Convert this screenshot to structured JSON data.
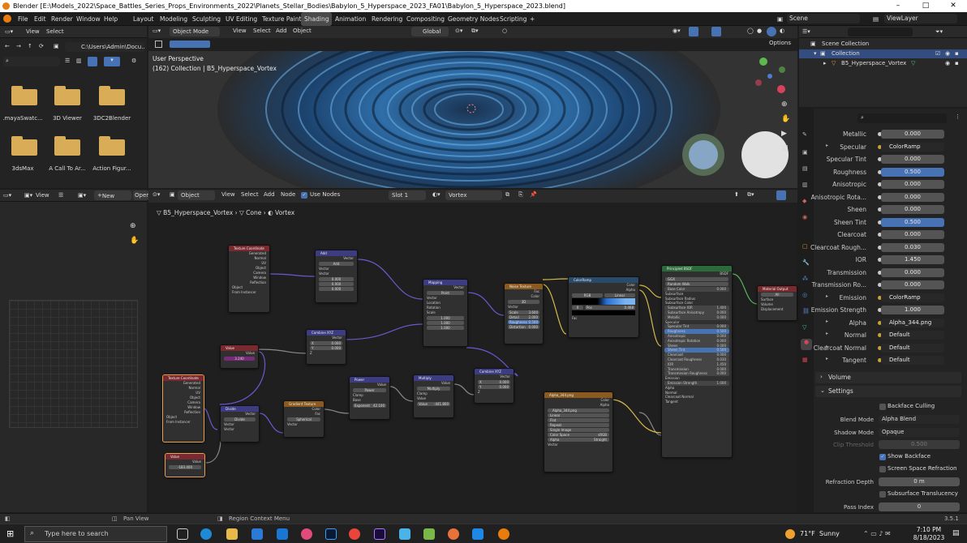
{
  "window": {
    "title": "Blender [E:\\Models_2022\\Space_Battles_Series_Props_Environments_2022\\Planets_Stellar_Bodies\\Babylon_5_Hyperspace_2023_FA01\\Babylon_5_Hyperspace_2023.blend]",
    "minimize": "–",
    "maximize": "□",
    "close": "✕"
  },
  "menu": {
    "file": "File",
    "edit": "Edit",
    "render": "Render",
    "window": "Window",
    "help": "Help"
  },
  "workspaces": [
    "Layout",
    "Modeling",
    "Sculpting",
    "UV Editing",
    "Texture Paint",
    "Shading",
    "Animation",
    "Rendering",
    "Compositing",
    "Geometry Nodes",
    "Scripting"
  ],
  "active_workspace": "Shading",
  "scene": {
    "label": "Scene",
    "viewlayer": "ViewLayer"
  },
  "filebrowser": {
    "view": "View",
    "select": "Select",
    "path": "C:\\Users\\Admin\\Docu...",
    "folders": [
      ".mayaSwatc...",
      "3D Viewer",
      "3DC2Blender",
      "3dsMax",
      "A Call To Ar...",
      "Action Figur..."
    ]
  },
  "viewport": {
    "mode": "Object Mode",
    "view": "View",
    "select": "Select",
    "add": "Add",
    "object": "Object",
    "orientation": "Global",
    "options": "Options",
    "overlay_title": "User Perspective",
    "overlay_sub": "(162) Collection | B5_Hyperspace_Vortex"
  },
  "outliner": {
    "scene_collection": "Scene Collection",
    "collection": "Collection",
    "object": "B5_Hyperspace_Vortex"
  },
  "imageeditor": {
    "view": "View",
    "new": "New",
    "open": "Open"
  },
  "nodeeditor": {
    "object": "Object",
    "view": "View",
    "select": "Select",
    "add": "Add",
    "node": "Node",
    "use_nodes": "Use Nodes",
    "slot": "Slot 1",
    "material": "Vortex",
    "breadcrumb": [
      "B5_Hyperspace_Vortex",
      "Cone",
      "Vortex"
    ]
  },
  "nodes": {
    "texcoord1": {
      "title": "Texture Coordinate",
      "outs": [
        "Generated",
        "Normal",
        "UV",
        "Object",
        "Camera",
        "Window",
        "Reflection"
      ],
      "object": "Object",
      "from_instancer": "From Instancer"
    },
    "add": {
      "title": "Add",
      "out": "Vector",
      "mode": "Add",
      "ins": [
        "Vector",
        "Vector"
      ],
      "vals": [
        "0.000",
        "0.000",
        "0.000"
      ]
    },
    "mapping": {
      "title": "Mapping",
      "out": "Vector",
      "type_lbl": "Type",
      "type": "Point",
      "ins": [
        "Vector",
        "Location",
        "Rotation",
        "Scale"
      ],
      "scale": [
        "1.000",
        "1.000",
        "1.000"
      ],
      "axes": [
        "X",
        "Y",
        "Z"
      ]
    },
    "noise": {
      "title": "Noise Texture",
      "outs": [
        "Fac",
        "Color"
      ],
      "dim": "3D",
      "ins": [
        "Vector"
      ],
      "fields": [
        "Scale",
        "Detail",
        "Roughness",
        "Distortion"
      ],
      "vals": [
        "3.600",
        "2.000",
        "0.500",
        "0.000"
      ]
    },
    "colorramp": {
      "title": "ColorRamp",
      "outs": [
        "Color",
        "Alpha"
      ],
      "mode": "RGB",
      "interp": "Linear",
      "pos_lbl": "Pos",
      "pos": "0.468",
      "idx": "0",
      "in": "Fac"
    },
    "combine1": {
      "title": "Combine XYZ",
      "out": "Vector",
      "ins": [
        "X",
        "Y",
        "Z"
      ],
      "vals": [
        "0.000",
        "0.000"
      ]
    },
    "value1": {
      "title": "Value",
      "out": "Value",
      "val": "3.240"
    },
    "texcoord2": {
      "title": "Texture Coordinate",
      "outs": [
        "Generated",
        "Normal",
        "UV",
        "Object",
        "Camera",
        "Window",
        "Reflection"
      ],
      "object": "Object",
      "from_instancer": "From Instancer"
    },
    "divide": {
      "title": "Divide",
      "out": "Vector",
      "mode": "Divide",
      "ins": [
        "Vector",
        "Vector"
      ]
    },
    "value2": {
      "title": "Value",
      "out": "Value",
      "val": "-183.400"
    },
    "gradient": {
      "title": "Gradient Texture",
      "outs": [
        "Color",
        "Fac"
      ],
      "type": "Spherical",
      "in": "Vector"
    },
    "power": {
      "title": "Power",
      "out": "Value",
      "mode": "Power",
      "clamp": "Clamp",
      "base": "Base",
      "exponent": "Exponent",
      "exp_val": "42.100"
    },
    "multiply": {
      "title": "Multiply",
      "out": "Value",
      "mode": "Multiply",
      "clamp": "Clamp",
      "in": "Value",
      "val_lbl": "Value",
      "val": "-441.800"
    },
    "combine2": {
      "title": "Combine XYZ",
      "out": "Vector",
      "ins": [
        "X",
        "Y",
        "Z"
      ],
      "vals": [
        "0.000",
        "0.000"
      ]
    },
    "image": {
      "title": "Alpha_344.png",
      "outs": [
        "Color",
        "Alpha"
      ],
      "file": "Alpha_344.png",
      "opts": [
        "Linear",
        "Flat",
        "Repeat",
        "Single Image"
      ],
      "cs_lbl": "Color Space",
      "cs": "sRGB",
      "alpha_lbl": "Alpha",
      "alpha": "Straight",
      "in": "Vector"
    },
    "bsdf": {
      "title": "Principled BSDF",
      "out": "BSDF",
      "dist": "GGX",
      "sss": "Random Walk",
      "ins": [
        "Base Color",
        "Subsurface",
        "Subsurface Radius",
        "Subsurface Color",
        "Subsurface IOR",
        "Subsurface Anisotropy",
        "Metallic",
        "Specular",
        "Specular Tint",
        "Roughness",
        "Anisotropic",
        "Anisotropic Rotation",
        "Sheen",
        "Sheen Tint",
        "Clearcoat",
        "Clearcoat Roughness",
        "IOR",
        "Transmission",
        "Transmission Roughness",
        "Emission",
        "Emission Strength",
        "Alpha",
        "Normal",
        "Clearcoat Normal",
        "Tangent"
      ],
      "vals": [
        "0.000",
        "",
        "",
        "",
        "1.400",
        "0.000",
        "0.000",
        "",
        "0.000",
        "0.500",
        "0.000",
        "0.000",
        "0.000",
        "0.500",
        "0.000",
        "0.030",
        "1.450",
        "0.000",
        "0.000",
        "",
        "1.000"
      ]
    },
    "output": {
      "title": "Material Output",
      "target": "All",
      "ins": [
        "Surface",
        "Volume",
        "Displacement"
      ]
    }
  },
  "properties": {
    "rows": [
      {
        "label": "Metallic",
        "value": "0.000",
        "kind": "num"
      },
      {
        "label": "Specular",
        "value": "ColorRamp",
        "kind": "link"
      },
      {
        "label": "Specular Tint",
        "value": "0.000",
        "kind": "num"
      },
      {
        "label": "Roughness",
        "value": "0.500",
        "kind": "blue"
      },
      {
        "label": "Anisotropic",
        "value": "0.000",
        "kind": "num"
      },
      {
        "label": "Anisotropic Rota...",
        "value": "0.000",
        "kind": "num"
      },
      {
        "label": "Sheen",
        "value": "0.000",
        "kind": "num"
      },
      {
        "label": "Sheen Tint",
        "value": "0.500",
        "kind": "blue"
      },
      {
        "label": "Clearcoat",
        "value": "0.000",
        "kind": "num"
      },
      {
        "label": "Clearcoat Rough...",
        "value": "0.030",
        "kind": "num"
      },
      {
        "label": "IOR",
        "value": "1.450",
        "kind": "num"
      },
      {
        "label": "Transmission",
        "value": "0.000",
        "kind": "num"
      },
      {
        "label": "Transmission Ro...",
        "value": "0.000",
        "kind": "num"
      },
      {
        "label": "Emission",
        "value": "ColorRamp",
        "kind": "link"
      },
      {
        "label": "Emission Strength",
        "value": "1.000",
        "kind": "num"
      },
      {
        "label": "Alpha",
        "value": "Alpha_344.png",
        "kind": "link"
      },
      {
        "label": "Normal",
        "value": "Default",
        "kind": "link"
      },
      {
        "label": "Clearcoat Normal",
        "value": "Default",
        "kind": "link"
      },
      {
        "label": "Tangent",
        "value": "Default",
        "kind": "link"
      }
    ],
    "volume": "Volume",
    "settings": "Settings",
    "backface_culling": "Backface Culling",
    "blend_mode_lbl": "Blend Mode",
    "blend_mode": "Alpha Blend",
    "shadow_mode_lbl": "Shadow Mode",
    "shadow_mode": "Opaque",
    "clip_lbl": "Clip Threshold",
    "clip": "0.500",
    "show_backface": "Show Backface",
    "ssr": "Screen Space Refraction",
    "refr_depth_lbl": "Refraction Depth",
    "refr_depth": "0 m",
    "sss_trans": "Subsurface Translucency",
    "pass_index_lbl": "Pass Index",
    "pass_index": "0"
  },
  "status": {
    "pan": "Pan View",
    "region": "Region Context Menu",
    "version": "3.5.1"
  },
  "taskbar": {
    "search": "Type here to search",
    "weather": "71°F  Sunny",
    "time": "7:10 PM",
    "date": "8/18/2023"
  }
}
